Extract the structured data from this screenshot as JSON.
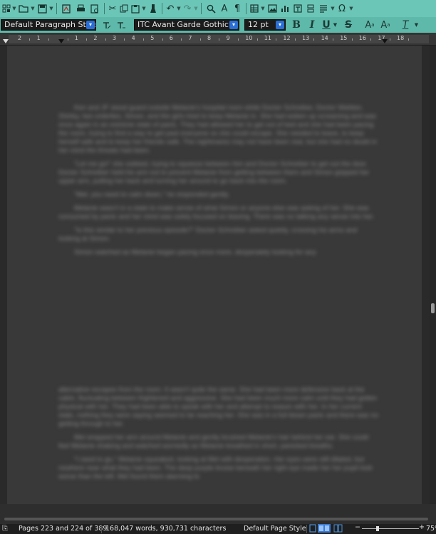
{
  "toolbar": {
    "icons": [
      "new-icon",
      "open-icon",
      "save-icon",
      "export-pdf-icon",
      "print-icon",
      "print-preview-icon",
      "cut-icon",
      "copy-icon",
      "paste-icon",
      "clone-icon",
      "undo-icon",
      "redo-icon",
      "find-icon",
      "spelling-icon",
      "formatting-marks-icon",
      "table-icon",
      "image-icon",
      "chart-icon",
      "text-box-icon",
      "page-break-icon",
      "field-icon",
      "special-character-icon"
    ]
  },
  "format_bar": {
    "paragraph_style": "Default Paragraph Style",
    "font_name": "ITC Avant Garde Gothic",
    "font_size": "12 pt",
    "bold": "B",
    "italic": "I",
    "underline": "U",
    "strikethrough": "S",
    "superscript": "A",
    "subscript": "A",
    "clear_format": "T"
  },
  "ruler": {
    "labels": [
      "2",
      "1",
      "",
      "1",
      "2",
      "3",
      "4",
      "5",
      "6",
      "7",
      "8",
      "9",
      "10",
      "11",
      "12",
      "13",
      "14",
      "15",
      "16",
      "17",
      "18"
    ]
  },
  "document": {
    "page1_paragraphs": [
      "Ken and JF stood guard outside Melanie's hospital room while Doctor Schreiber, Doctor Webber, Shirley, two orderlies, Simon, and the girls tried to keep Melanie in. She had woken up screaming and was once again in an extreme state of panic. They had allowed her to get out of bed and she had been pacing the room, trying to find a way to get past everyone so she could escape. She needed to leave, to keep herself safe and to keep her friends safe. The nightmares may not have been real, but she had no doubt in her mind the threats had been.",
      "\"Let me go!\" she sobbed, trying to squeeze between him and Doctor Schreiber to get out the door. Doctor Schreiber held his arm out to prevent Melanie from getting between them and Simon gripped her upper arm, pulling her back and turning her around to go back into the room.",
      "\"Mel, you need to calm down,\" he responded gently.",
      "Melanie wasn't in a state to make sense of what Simon or anyone else was asking of her. She was consumed by panic and her mind was solely focused on leaving. There was no talking any sense into her.",
      "\"Is this similar to her previous episode?\" Doctor Schreiber asked quietly, crossing his arms and looking at Simon.",
      "Simon watched as Melanie began pacing once more, desperately looking for any"
    ],
    "page2_paragraphs": [
      "alternative escapes from the room. It wasn't quite the same. She had been more defensive back at the cabin, fluctuating between frightened and aggressive. She had been much more calm until they had gotten physical with her. They had been able to speak with her and attempt to reason with her. In her current state, nothing they were saying seemed to be reaching her. She was in a full blown panic and there was no getting through to her.",
      "Mel wrapped her arm around Melanie and gently brushed Melanie's hair behind her ear. She could feel Melanie shaking and watched worriedly as Melanie breathed in short, panicked breaths.",
      "\"I need to go,\" Melanie squeaked, looking at Mel with desperation. Her eyes were still dilated, but nowhere near what they had been. The deep purple bruise beneath her right eye made her her pupil look worse than the left. Mel found them alarming to"
    ]
  },
  "status_bar": {
    "page_info": "Pages 223 and 224 of 389",
    "word_count": "168,047 words, 930,731 characters",
    "page_style": "Default Page Style",
    "zoom": "75%"
  }
}
